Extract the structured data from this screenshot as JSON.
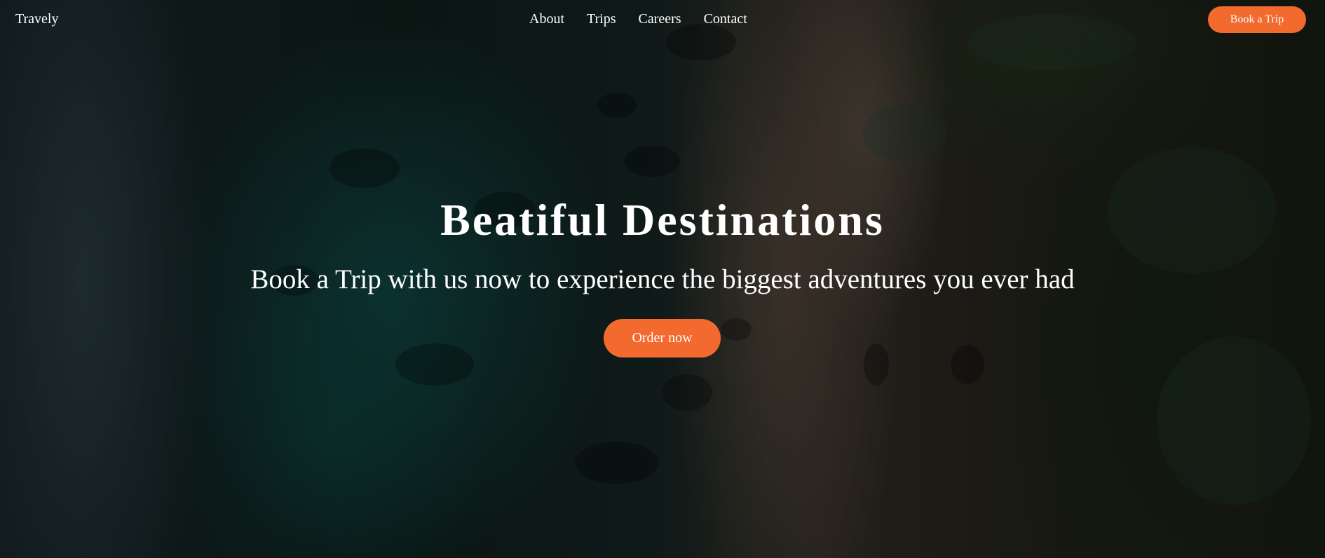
{
  "brand": {
    "name": "Travely"
  },
  "nav": {
    "links": [
      {
        "label": "About"
      },
      {
        "label": "Trips"
      },
      {
        "label": "Careers"
      },
      {
        "label": "Contact"
      }
    ],
    "cta_label": "Book a Trip"
  },
  "hero": {
    "title": "Beatiful Destinations",
    "subtitle": "Book a Trip with us now to experience the biggest adventures you ever had",
    "cta_label": "Order now",
    "background_image": "aerial-coastline-beach-photo"
  },
  "colors": {
    "accent": "#f26a2e",
    "text": "#ffffff"
  }
}
